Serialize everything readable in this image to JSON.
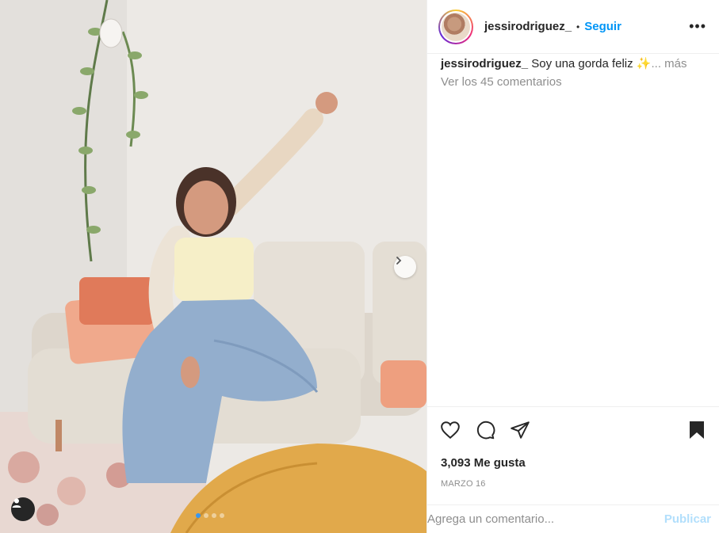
{
  "post": {
    "username": "jessirodriguez_",
    "separator": "•",
    "follow_label": "Seguir",
    "more_options": "•••",
    "caption_user": "jessirodriguez_",
    "caption_text": "Soy una gorda feliz ✨",
    "caption_more": "... más",
    "view_comments": "Ver los 45 comentarios",
    "likes": "3,093 Me gusta",
    "date": "MARZO 16",
    "comment_placeholder": "Agrega un comentario...",
    "publish_label": "Publicar"
  },
  "carousel": {
    "slides": 4,
    "active_index": 0
  },
  "icons": {
    "like": "heart-icon",
    "comment": "comment-icon",
    "share": "send-icon",
    "save": "bookmark-icon",
    "next": "chevron-right-icon",
    "tagged": "user-tag-icon"
  },
  "colors": {
    "follow": "#0095f6",
    "publish_disabled": "#b2dffc",
    "carousel_active": "#3897f0"
  }
}
